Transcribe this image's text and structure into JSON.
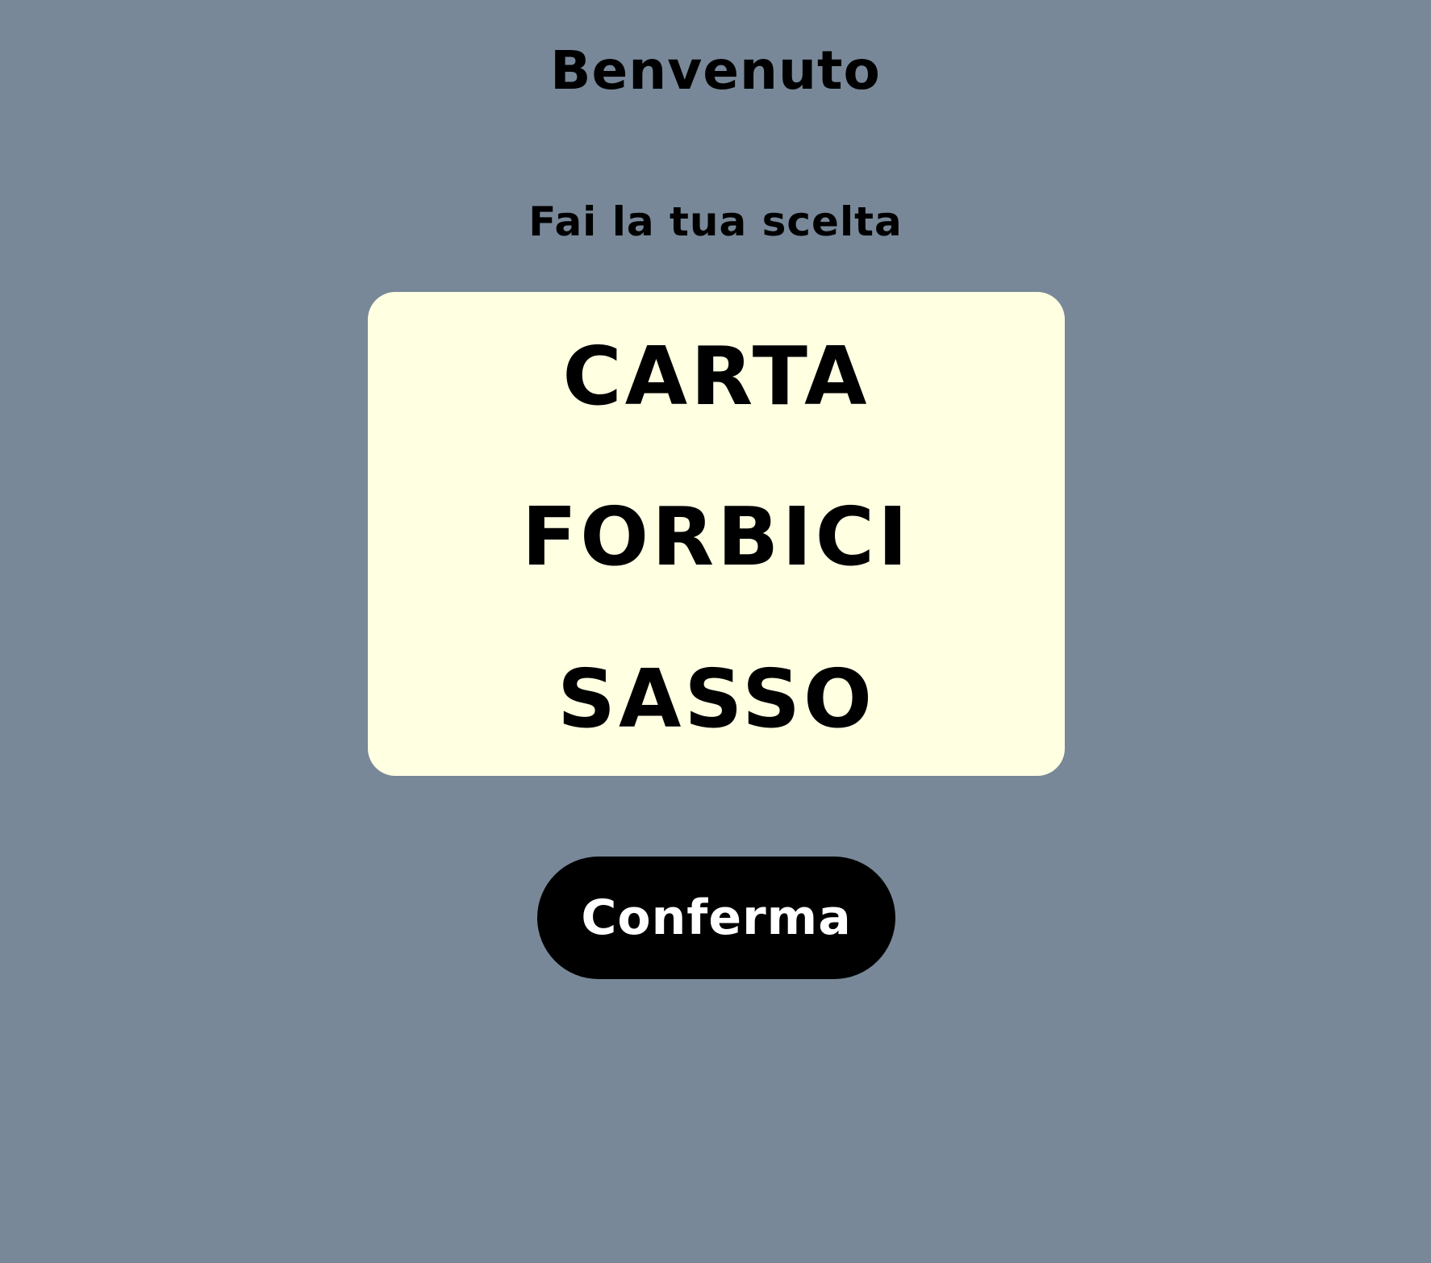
{
  "header": {
    "title": "Benvenuto",
    "subtitle": "Fai la tua scelta"
  },
  "choices": [
    {
      "label": "CARTA"
    },
    {
      "label": "FORBICI"
    },
    {
      "label": "SASSO"
    }
  ],
  "actions": {
    "confirm_label": "Conferma"
  },
  "colors": {
    "background": "#788898",
    "panel": "#ffffe2",
    "button": "#000000",
    "button_text": "#ffffff"
  }
}
